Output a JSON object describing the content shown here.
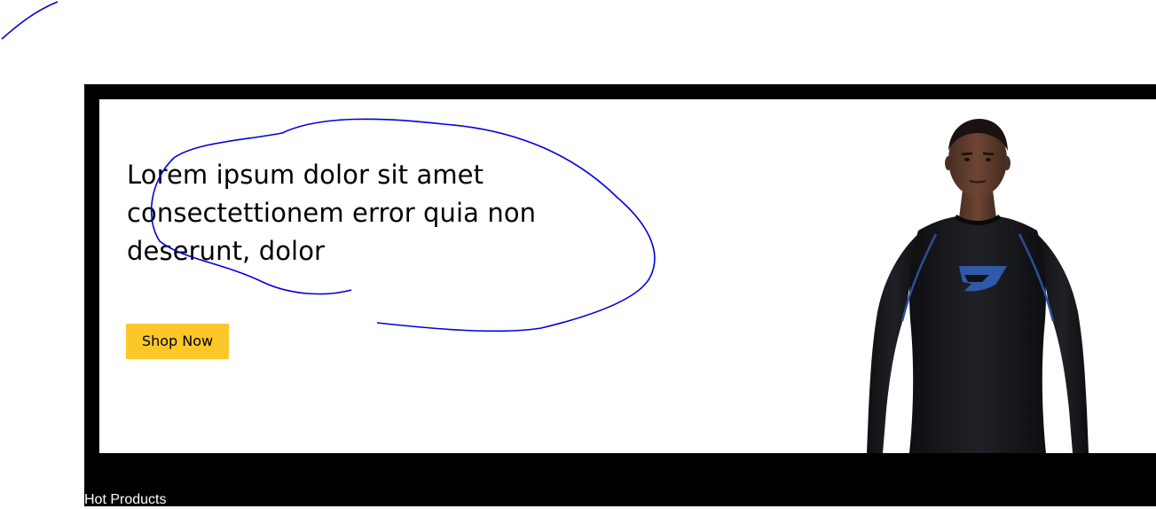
{
  "hero": {
    "headline": "Lorem ipsum dolor sit amet consectettionem error quia non deserunt, dolor",
    "button_label": "Shop Now",
    "image": "male-model-black-compression-shirt"
  },
  "section": {
    "title": "Hot Products"
  },
  "colors": {
    "frame": "#000000",
    "panel": "#ffffff",
    "button": "#fcc728",
    "annotation": "#0000dd"
  }
}
